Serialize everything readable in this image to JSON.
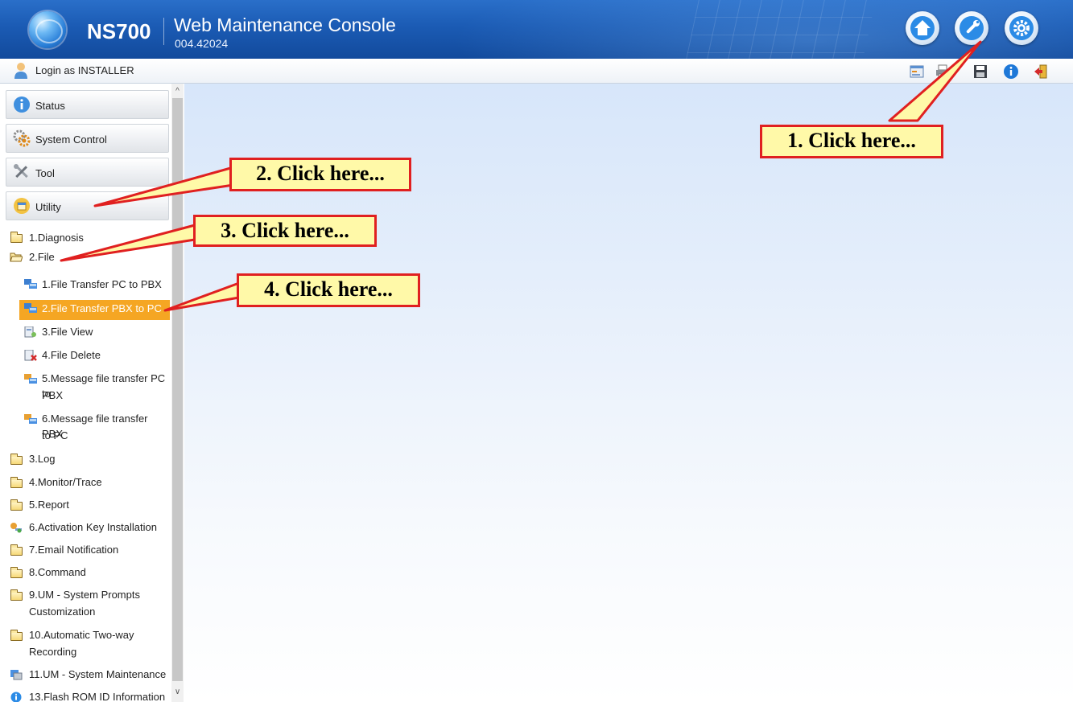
{
  "header": {
    "model": "NS700",
    "title": "Web Maintenance Console",
    "version": "004.42024",
    "buttons": [
      {
        "name": "home",
        "icon": "home-icon"
      },
      {
        "name": "tool",
        "icon": "wrench-icon"
      },
      {
        "name": "setup",
        "icon": "gear-icon"
      }
    ]
  },
  "login": {
    "text": "Login as INSTALLER"
  },
  "toolbar": {
    "icons": [
      "system-data-icon",
      "print-icon",
      "save-icon",
      "info-icon",
      "logout-icon"
    ]
  },
  "sidebar": {
    "categories": [
      {
        "label": "Status",
        "icon": "status-info-icon"
      },
      {
        "label": "System Control",
        "icon": "gears-icon"
      },
      {
        "label": "Tool",
        "icon": "tools-icon"
      },
      {
        "label": "Utility",
        "icon": "utility-box-icon"
      }
    ],
    "tree": [
      {
        "label": "1.Diagnosis",
        "icon": "folder-closed-icon"
      },
      {
        "label": "2.File",
        "icon": "folder-open-icon"
      },
      {
        "label": "1.File Transfer PC to PBX",
        "icon": "transfer-icon"
      },
      {
        "label": "2.File Transfer PBX to PC",
        "icon": "transfer-icon",
        "selected": true
      },
      {
        "label": "3.File View",
        "icon": "file-view-icon"
      },
      {
        "label": "4.File Delete",
        "icon": "file-delete-icon"
      },
      {
        "label": "5.Message file transfer PC to",
        "label2": "PBX",
        "icon": "transfer-icon"
      },
      {
        "label": "6.Message file transfer PBX",
        "label2": "to PC",
        "icon": "transfer-icon"
      },
      {
        "label": "3.Log",
        "icon": "folder-closed-icon"
      },
      {
        "label": "4.Monitor/Trace",
        "icon": "folder-closed-icon"
      },
      {
        "label": "5.Report",
        "icon": "folder-closed-icon"
      },
      {
        "label": "6.Activation Key Installation",
        "icon": "key-icon"
      },
      {
        "label": "7.Email Notification",
        "icon": "folder-closed-icon"
      },
      {
        "label": "8.Command",
        "icon": "folder-closed-icon"
      },
      {
        "label": "9.UM - System Prompts",
        "label2": "Customization",
        "icon": "folder-closed-icon"
      },
      {
        "label": "10.Automatic Two-way",
        "label2": "Recording",
        "icon": "folder-closed-icon"
      },
      {
        "label": "11.UM - System Maintenance",
        "icon": "maintenance-icon"
      },
      {
        "label": "13.Flash ROM ID Information",
        "icon": "globe-info-icon"
      }
    ]
  },
  "callouts": [
    {
      "text": "1. Click here..."
    },
    {
      "text": "2. Click here..."
    },
    {
      "text": "3. Click here..."
    },
    {
      "text": "4. Click here..."
    }
  ],
  "colors": {
    "header_blue": "#1b5bb4",
    "selected_orange": "#f5a623",
    "callout_fill": "#fff9a8",
    "callout_border": "#e02020"
  }
}
